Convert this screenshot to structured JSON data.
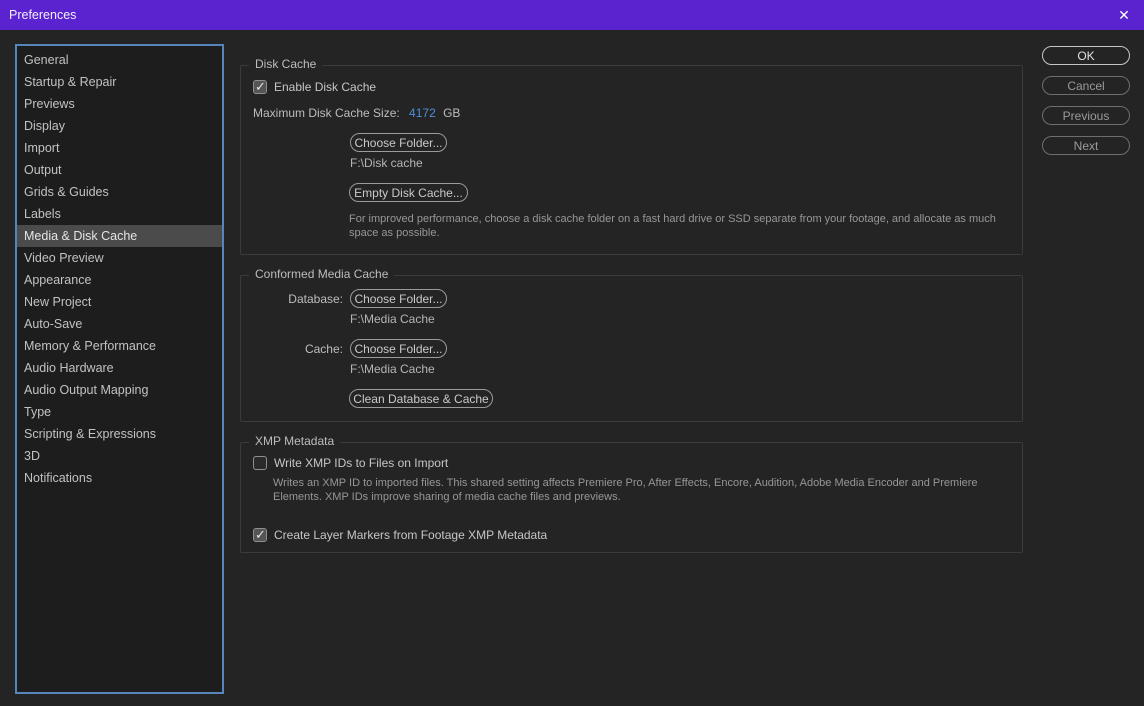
{
  "titlebar": {
    "title": "Preferences",
    "close_glyph": "✕"
  },
  "colors": {
    "titlebar_purple": "#5b23cf",
    "sidebar_focus_border": "#5585bb",
    "selected_row": "#4b4b4b",
    "hot_text_blue": "#4a90d8",
    "background": "#242424"
  },
  "sidebar": {
    "selected_index": 8,
    "items": [
      "General",
      "Startup & Repair",
      "Previews",
      "Display",
      "Import",
      "Output",
      "Grids & Guides",
      "Labels",
      "Media & Disk Cache",
      "Video Preview",
      "Appearance",
      "New Project",
      "Auto-Save",
      "Memory & Performance",
      "Audio Hardware",
      "Audio Output Mapping",
      "Type",
      "Scripting & Expressions",
      "3D",
      "Notifications"
    ]
  },
  "sections": {
    "disk_cache": {
      "title": "Disk Cache",
      "enable_checkbox": {
        "label": "Enable Disk Cache",
        "checked": true
      },
      "max_size": {
        "label": "Maximum Disk Cache Size:",
        "value": "4172",
        "unit": "GB"
      },
      "choose_folder_button": "Choose Folder...",
      "folder_path": "F:\\Disk cache",
      "empty_button": "Empty Disk Cache...",
      "note": "For improved performance, choose a disk cache folder on a fast hard drive or SSD separate from your footage, and allocate as much space as possible."
    },
    "conformed_media_cache": {
      "title": "Conformed Media Cache",
      "database": {
        "label": "Database:",
        "button": "Choose Folder...",
        "path": "F:\\Media Cache"
      },
      "cache": {
        "label": "Cache:",
        "button": "Choose Folder...",
        "path": "F:\\Media Cache"
      },
      "clean_button": "Clean Database & Cache"
    },
    "xmp_metadata": {
      "title": "XMP Metadata",
      "write_ids_checkbox": {
        "label": "Write XMP IDs to Files on Import",
        "checked": false
      },
      "note": "Writes an XMP ID to imported files. This shared setting affects Premiere Pro, After Effects, Encore, Audition, Adobe Media Encoder and Premiere Elements. XMP IDs improve sharing of media cache files and previews.",
      "layer_markers_checkbox": {
        "label": "Create Layer Markers from Footage XMP Metadata",
        "checked": true
      }
    }
  },
  "action_buttons": {
    "ok": "OK",
    "cancel": "Cancel",
    "previous": "Previous",
    "next": "Next"
  }
}
